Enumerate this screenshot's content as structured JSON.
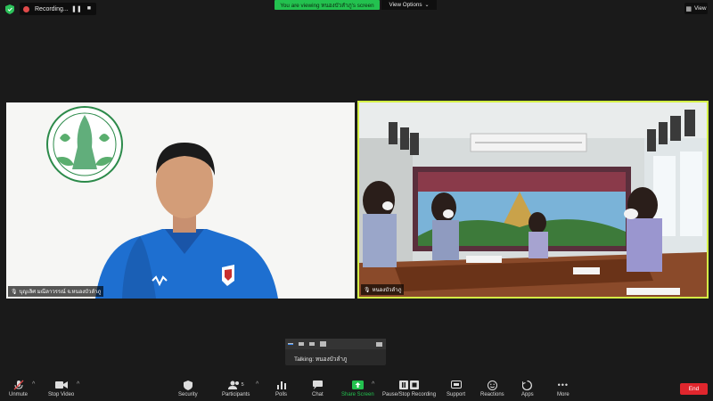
{
  "top": {
    "recording_label": "Recording...",
    "viewing_banner": "You are viewing หนองบัวลำภู's screen",
    "view_options_label": "View Options",
    "view_label": "View"
  },
  "participants": {
    "left_name": "บุญเลิศ มณีลาวรรณ์ จ.หนองบัวลำภู",
    "right_name": "หนองบัวลำภู"
  },
  "mini_panel": {
    "talking": "Talking: หนองบัวลำภู"
  },
  "toolbar": {
    "unmute": "Unmute",
    "stop_video": "Stop Video",
    "security": "Security",
    "participants": "Participants",
    "participants_count": "5",
    "polls": "Polls",
    "chat": "Chat",
    "share_screen": "Share Screen",
    "pause_recording": "Pause/Stop Recording",
    "support": "Support",
    "reactions": "Reactions",
    "apps": "Apps",
    "more": "More",
    "end": "End"
  },
  "colors": {
    "accent_green": "#23c14f",
    "active_speaker": "#d4ef46",
    "end_red": "#e0262d"
  }
}
